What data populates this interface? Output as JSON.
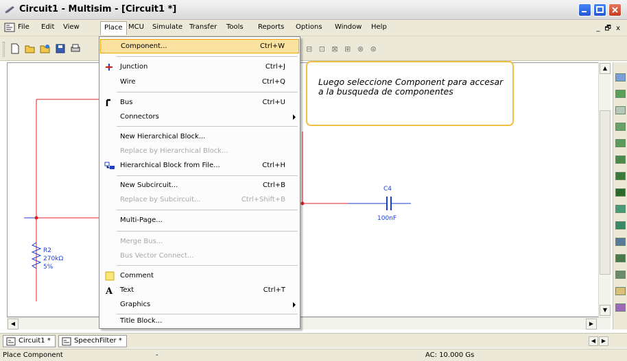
{
  "window": {
    "title": "Circuit1 - Multisim - [Circuit1 *]",
    "controls": [
      "minimize",
      "maximize",
      "close"
    ]
  },
  "menubar": {
    "items": [
      "File",
      "Edit",
      "View",
      "Place",
      "MCU",
      "Simulate",
      "Transfer",
      "Tools",
      "Reports",
      "Options",
      "Window",
      "Help"
    ],
    "active": "Place",
    "mdi_controls": "_ 🗗 x"
  },
  "place_menu": {
    "items": [
      {
        "label": "Component...",
        "shortcut": "Ctrl+W",
        "icon": "component-icon",
        "enabled": true,
        "highlighted": true
      },
      {
        "label": "Junction",
        "shortcut": "Ctrl+J",
        "icon": "junction-icon",
        "enabled": true
      },
      {
        "label": "Wire",
        "shortcut": "Ctrl+Q",
        "enabled": true
      },
      {
        "label": "Bus",
        "shortcut": "Ctrl+U",
        "icon": "bus-icon",
        "enabled": true
      },
      {
        "label": "Connectors",
        "shortcut": "",
        "submenu": true,
        "enabled": true
      },
      {
        "label": "New Hierarchical Block...",
        "shortcut": "",
        "enabled": true
      },
      {
        "label": "Replace by Hierarchical Block...",
        "shortcut": "",
        "enabled": false
      },
      {
        "label": "Hierarchical Block from File...",
        "shortcut": "Ctrl+H",
        "icon": "hierarchical-block-icon",
        "enabled": true
      },
      {
        "label": "New Subcircuit...",
        "shortcut": "Ctrl+B",
        "enabled": true
      },
      {
        "label": "Replace by Subcircuit...",
        "shortcut": "Ctrl+Shift+B",
        "enabled": false
      },
      {
        "label": "Multi-Page...",
        "shortcut": "",
        "enabled": true
      },
      {
        "label": "Merge Bus...",
        "shortcut": "",
        "enabled": false
      },
      {
        "label": "Bus Vector Connect...",
        "shortcut": "",
        "enabled": false
      },
      {
        "label": "Comment",
        "shortcut": "",
        "icon": "comment-icon",
        "enabled": true
      },
      {
        "label": "Text",
        "shortcut": "Ctrl+T",
        "icon": "text-icon",
        "enabled": true
      },
      {
        "label": "Graphics",
        "shortcut": "",
        "submenu": true,
        "enabled": true
      },
      {
        "label": "Title Block...",
        "shortcut": "",
        "enabled": true
      }
    ]
  },
  "callout": {
    "text": "Luego seleccione Component para accesar a la busqueda de componentes"
  },
  "schematic": {
    "capacitor_name": "C4",
    "capacitor_value": "100nF",
    "resistor_name": "R2",
    "resistor_value": "270kΩ",
    "resistor_tolerance": "5%"
  },
  "tabs": [
    "Circuit1 *",
    "SpeechFilter *"
  ],
  "statusbar": {
    "message": "Place Component",
    "center": "-",
    "analysis": "AC: 10.000 Gs"
  },
  "colors": {
    "wire": "#e02020",
    "component": "#1a3cd8",
    "menu_highlight": "#fbe2a0",
    "callout_border": "#f0c040"
  }
}
